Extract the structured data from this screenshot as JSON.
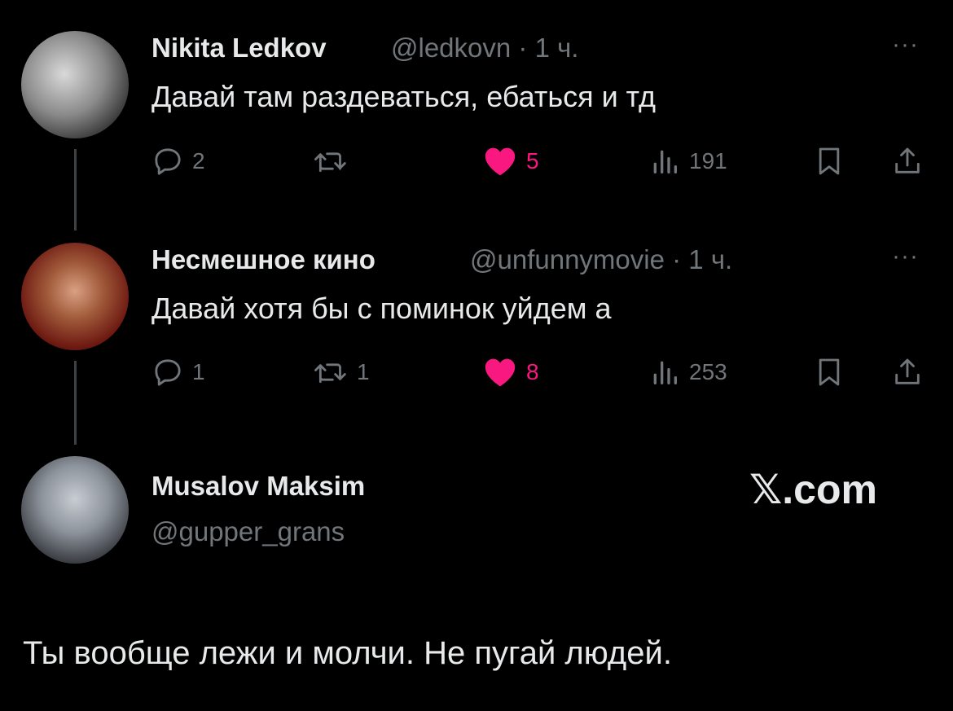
{
  "tweets": [
    {
      "name": "Nikita Ledkov",
      "handle": "@ledkovn",
      "time": "· 1 ч.",
      "text": "Давай там раздеваться, ебаться и тд",
      "replies": "2",
      "retweets": "",
      "likes": "5",
      "views": "191"
    },
    {
      "name": "Несмешное кино",
      "handle": "@unfunnymovie",
      "time": "· 1 ч.",
      "text": "Давай хотя бы с поминок уйдем а",
      "replies": "1",
      "retweets": "1",
      "likes": "8",
      "views": "253"
    }
  ],
  "main_tweet": {
    "name": "Musalov Maksim",
    "handle": "@gupper_grans",
    "text": "Ты вообще лежи и молчи. Не пугай людей."
  },
  "watermark": "𝕏.com",
  "more_label": "···",
  "colors": {
    "background": "#000000",
    "text": "#e7e9ea",
    "muted": "#71767b",
    "like": "#f91880",
    "thread": "#3e4144"
  }
}
